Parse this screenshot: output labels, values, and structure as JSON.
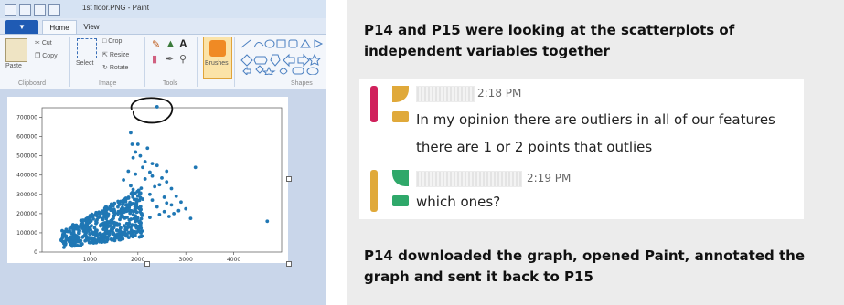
{
  "paint": {
    "window_title": "1st floor.PNG - Paint",
    "tabs": {
      "home": "Home",
      "view": "View"
    },
    "clipboard": {
      "paste": "Paste",
      "cut": "Cut",
      "copy": "Copy",
      "group": "Clipboard"
    },
    "image": {
      "select": "Select",
      "crop": "Crop",
      "resize": "Resize",
      "rotate": "Rotate",
      "group": "Image"
    },
    "tools": {
      "group": "Tools",
      "text_tool": "A"
    },
    "brushes": "Brushes",
    "shapes_group": "Shapes",
    "accent": "#1f5bb4"
  },
  "chart_data": {
    "type": "scatter",
    "title": "",
    "xlabel": "",
    "ylabel": "",
    "xlim": [
      0,
      5000
    ],
    "ylim": [
      0,
      750000
    ],
    "xticks": [
      "1000",
      "2000",
      "3000",
      "4000"
    ],
    "yticks": [
      "0",
      "100000",
      "200000",
      "300000",
      "400000",
      "500000",
      "600000",
      "700000"
    ],
    "color": "#1f77b4",
    "series": [
      {
        "values": [
          [
            2400,
            755000
          ],
          [
            1850,
            620000
          ],
          [
            1880,
            560000
          ],
          [
            2000,
            560000
          ],
          [
            2200,
            540000
          ],
          [
            1950,
            520000
          ],
          [
            2050,
            500000
          ],
          [
            1900,
            490000
          ],
          [
            2150,
            470000
          ],
          [
            2300,
            460000
          ],
          [
            2400,
            450000
          ],
          [
            2100,
            440000
          ],
          [
            3200,
            440000
          ],
          [
            2600,
            420000
          ],
          [
            1800,
            420000
          ],
          [
            2250,
            415000
          ],
          [
            1950,
            405000
          ],
          [
            2300,
            395000
          ],
          [
            2500,
            385000
          ],
          [
            2150,
            380000
          ],
          [
            1700,
            375000
          ],
          [
            2600,
            365000
          ],
          [
            2450,
            350000
          ],
          [
            1850,
            345000
          ],
          [
            2350,
            340000
          ],
          [
            2700,
            330000
          ],
          [
            1900,
            325000
          ],
          [
            2000,
            315000
          ],
          [
            2250,
            300000
          ],
          [
            2800,
            290000
          ],
          [
            2550,
            285000
          ],
          [
            1750,
            280000
          ],
          [
            2100,
            275000
          ],
          [
            2300,
            270000
          ],
          [
            2900,
            260000
          ],
          [
            2600,
            255000
          ],
          [
            2700,
            245000
          ],
          [
            1800,
            240000
          ],
          [
            2400,
            235000
          ],
          [
            3000,
            225000
          ],
          [
            2850,
            215000
          ],
          [
            2550,
            210000
          ],
          [
            2750,
            200000
          ],
          [
            2450,
            195000
          ],
          [
            2650,
            185000
          ],
          [
            2250,
            180000
          ],
          [
            4700,
            160000
          ],
          [
            3100,
            175000
          ]
        ],
        "dense_region": {
          "x_from": 400,
          "x_to": 2100,
          "y_low_at_start": 20000,
          "y_high_at_start": 110000,
          "y_low_at_end": 80000,
          "y_high_at_end": 340000
        }
      }
    ]
  },
  "narrative": {
    "top": "P14 and P15 were looking at the scatterplots of independent variables together",
    "bottom": "P14 downloaded the graph, opened Paint, annotated the graph and sent it back to P15"
  },
  "chat": {
    "messages": [
      {
        "time": "2:18 PM",
        "lines": [
          "In my opinion there are outliers in all of our features",
          "there are 1 or 2 points that outlies"
        ]
      },
      {
        "time": "2:19 PM",
        "lines": [
          "which ones?"
        ]
      }
    ]
  }
}
